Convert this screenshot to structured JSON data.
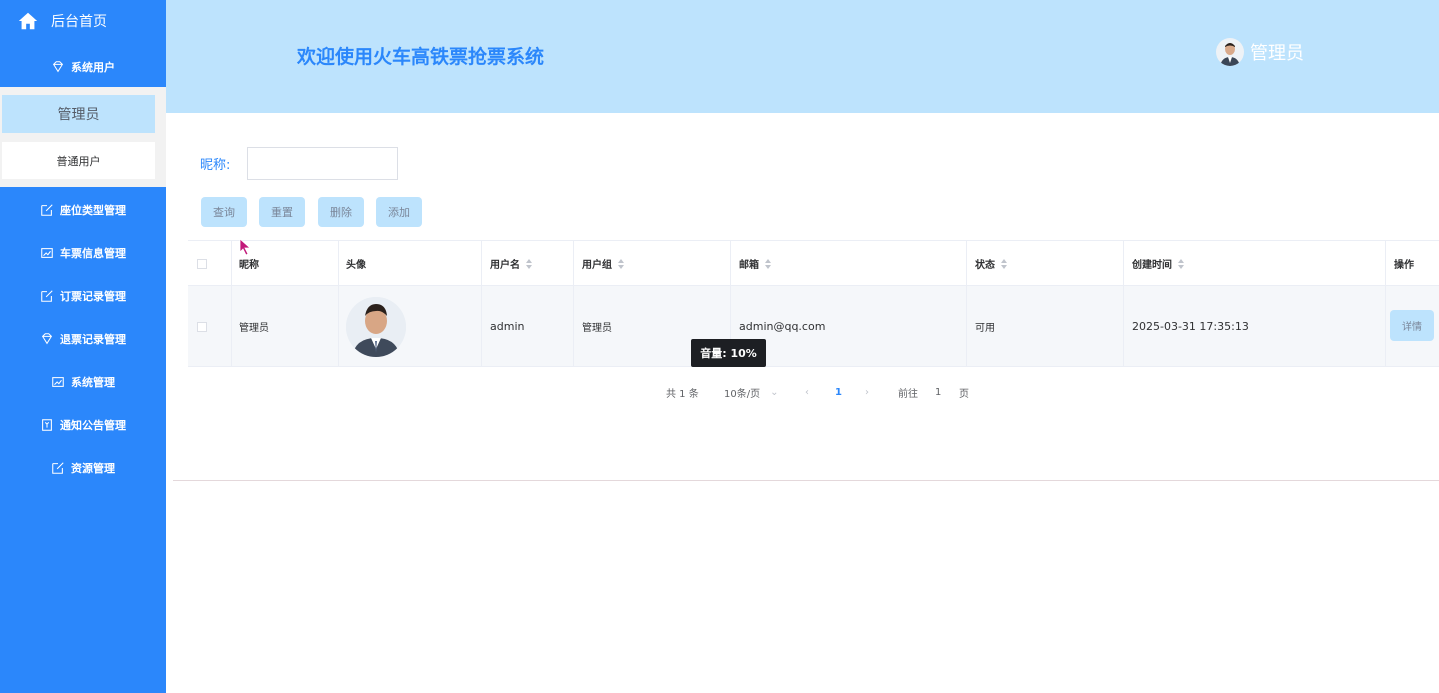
{
  "sidebar": {
    "home_label": "后台首页",
    "menu": [
      {
        "label": "系统用户",
        "icon": "diamond-icon"
      },
      {
        "label": "座位类型管理",
        "icon": "edit-icon"
      },
      {
        "label": "车票信息管理",
        "icon": "chart-icon"
      },
      {
        "label": "订票记录管理",
        "icon": "edit-icon"
      },
      {
        "label": "退票记录管理",
        "icon": "diamond-icon"
      },
      {
        "label": "系统管理",
        "icon": "chart-icon"
      },
      {
        "label": "通知公告管理",
        "icon": "bookmark-icon"
      },
      {
        "label": "资源管理",
        "icon": "edit-icon"
      }
    ],
    "submenu": [
      {
        "label": "管理员"
      },
      {
        "label": "普通用户"
      }
    ]
  },
  "header": {
    "title": "欢迎使用火车高铁票抢票系统",
    "user_label": "管理员"
  },
  "search": {
    "label": "昵称:",
    "value": "",
    "buttons": {
      "query": "查询",
      "reset": "重置",
      "delete": "删除",
      "add": "添加"
    }
  },
  "table": {
    "headers": {
      "nickname": "昵称",
      "avatar": "头像",
      "username": "用户名",
      "group": "用户组",
      "email": "邮箱",
      "status": "状态",
      "created": "创建时间",
      "actions": "操作"
    },
    "rows": [
      {
        "nickname": "管理员",
        "username": "admin",
        "group": "管理员",
        "email": "admin@qq.com",
        "status": "可用",
        "created": "2025-03-31 17:35:13",
        "action_label": "详情"
      }
    ]
  },
  "tooltip": {
    "text": "音量: 10%"
  },
  "pagination": {
    "total": "共 1 条",
    "page_size": "10条/页",
    "current_page": "1",
    "goto_prefix": "前往",
    "goto_value": "1",
    "goto_suffix": "页"
  },
  "colors": {
    "sidebar": "#2b87fb",
    "header": "#bde3fd",
    "accent": "#2b87fb",
    "button": "#bde3fd"
  }
}
